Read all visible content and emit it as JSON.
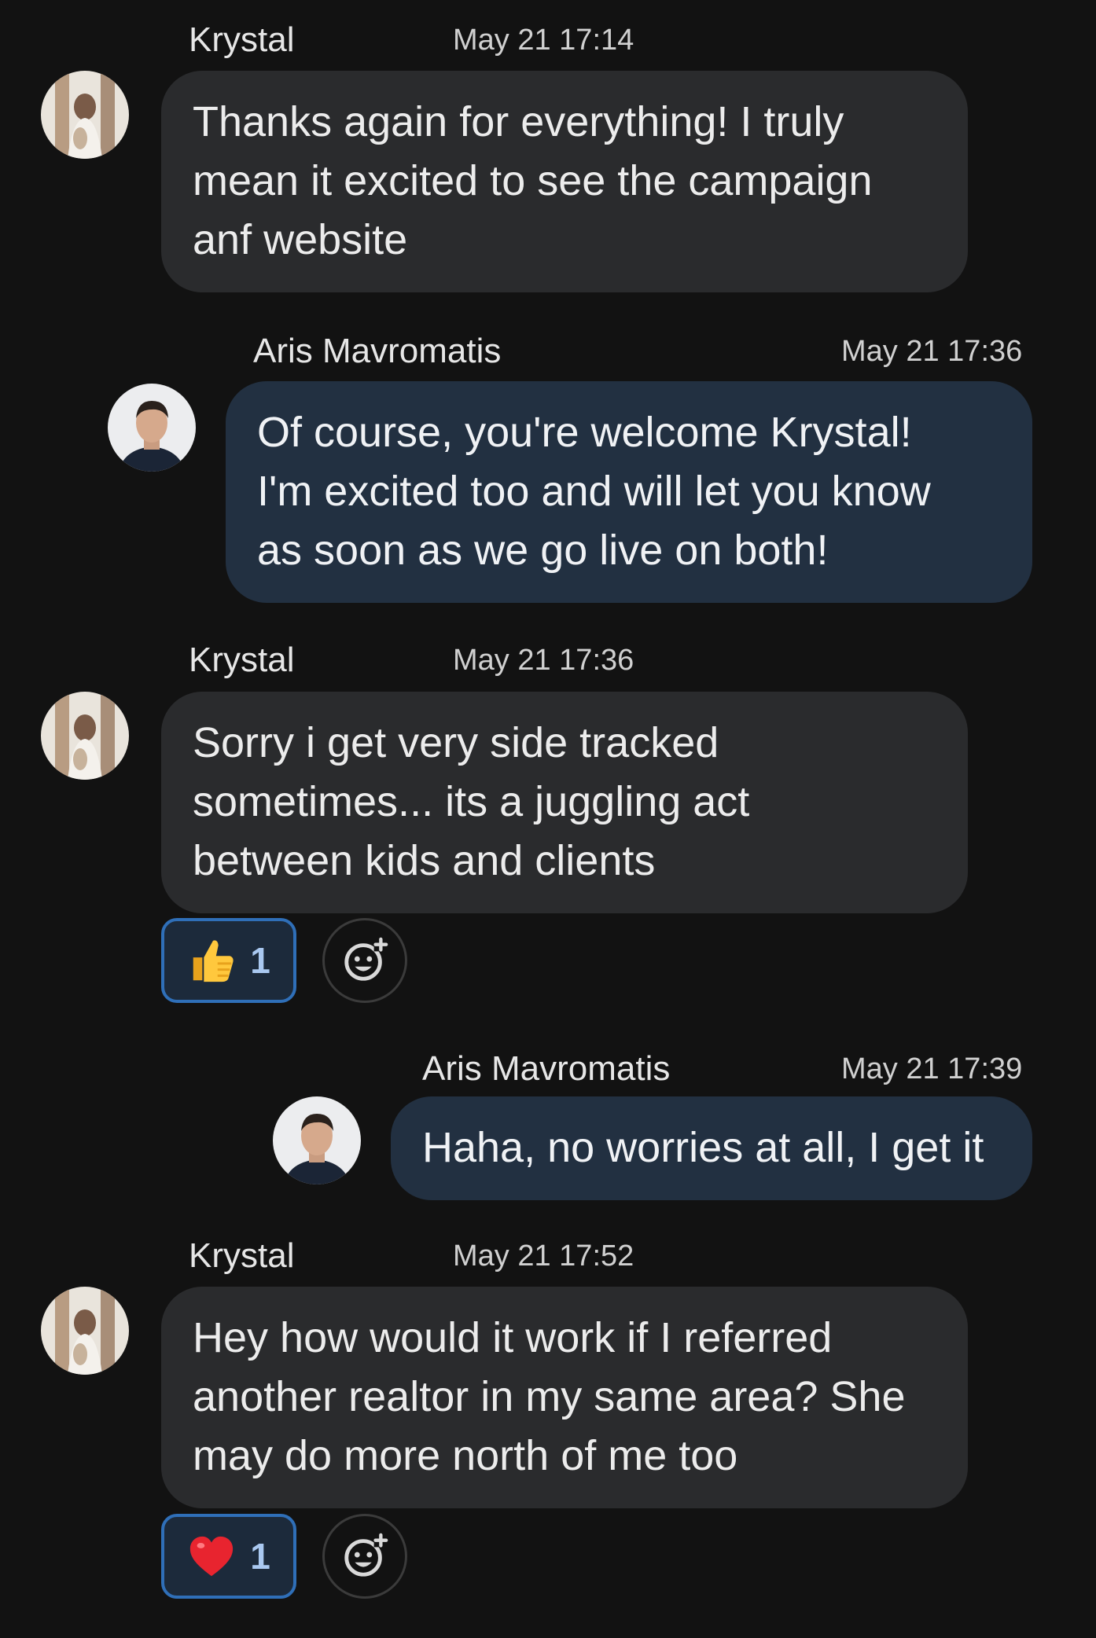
{
  "messages": [
    {
      "sender": "Krystal",
      "time": "May 21 17:14",
      "lines": [
        "Thanks again for everything! I truly",
        "mean it excited to see the campaign",
        "anf website"
      ]
    },
    {
      "sender": "Aris Mavromatis",
      "time": "May 21 17:36",
      "lines": [
        "Of course, you're welcome Krystal!",
        "I'm excited too and will let you know",
        "as soon as we go live on both!"
      ]
    },
    {
      "sender": "Krystal",
      "time": "May 21 17:36",
      "lines": [
        "Sorry i get very side tracked",
        "sometimes... its a juggling act",
        "between kids and clients"
      ],
      "reaction": {
        "emoji": "thumbs-up",
        "count": "1"
      }
    },
    {
      "sender": "Aris Mavromatis",
      "time": "May 21 17:39",
      "lines": [
        "Haha, no worries at all, I get it"
      ]
    },
    {
      "sender": "Krystal",
      "time": "May 21 17:52",
      "lines": [
        "Hey how would it work if I referred",
        "another realtor in my same area? She",
        "may do more north of me too"
      ],
      "reaction": {
        "emoji": "red-heart",
        "count": "1"
      }
    }
  ],
  "icons": {
    "add_reaction": "add-reaction-icon",
    "thumbs_up": "thumbs-up-icon",
    "heart": "red-heart-icon"
  },
  "colors": {
    "background": "#121212",
    "incoming_bubble": "#2a2b2d",
    "outgoing_bubble": "#223041",
    "reaction_border": "#2f6fb8"
  }
}
